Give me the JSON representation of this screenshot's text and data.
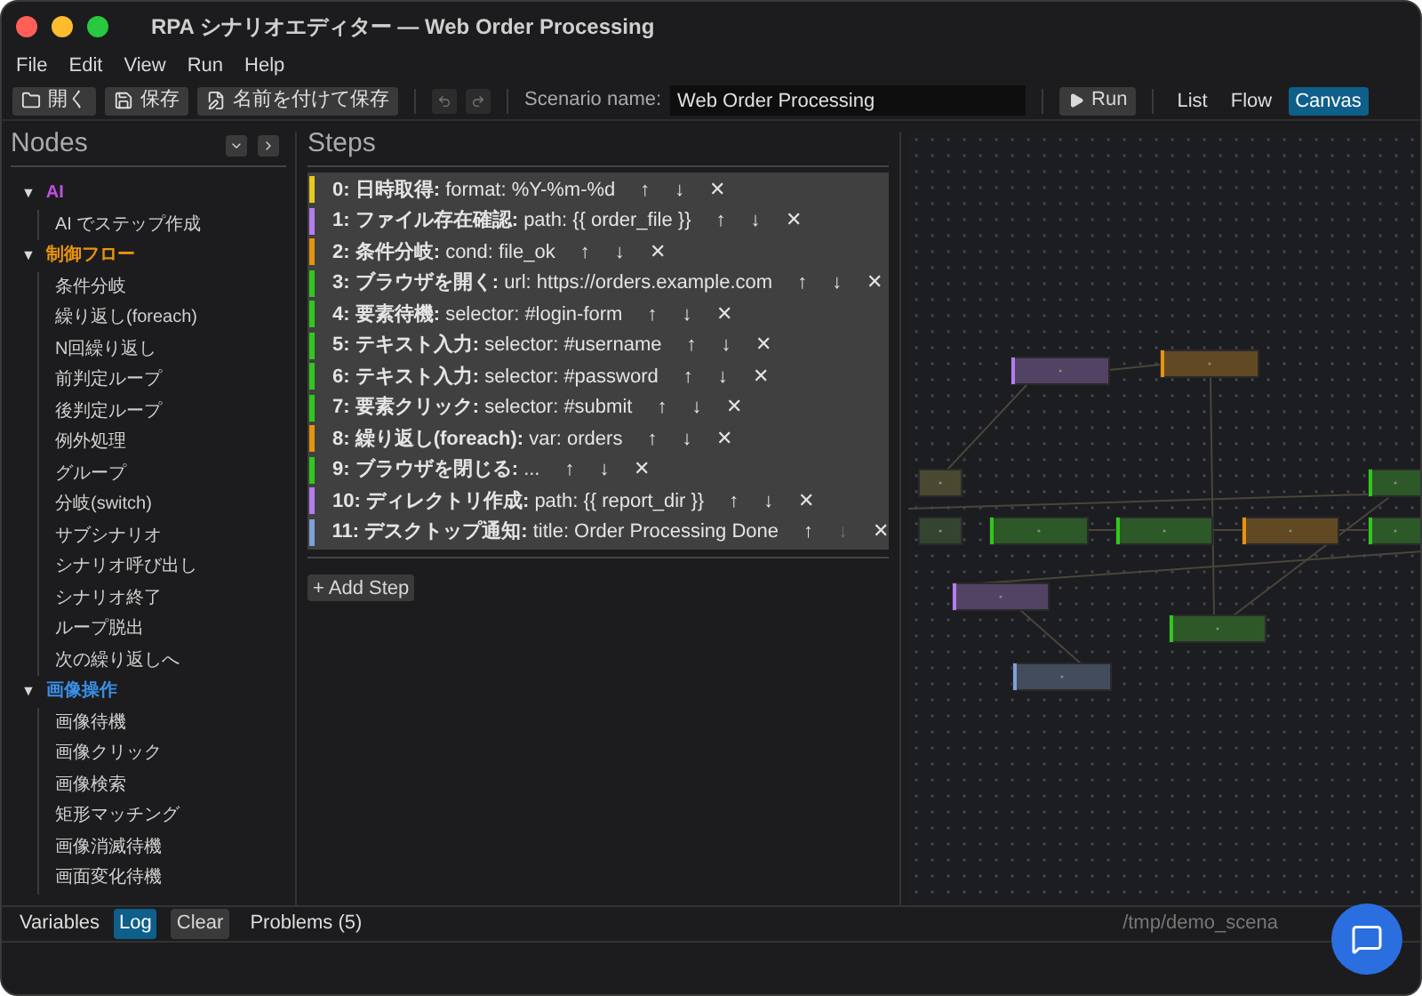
{
  "window": {
    "title": "RPA シナリオエディター — Web Order Processing"
  },
  "menu": [
    "File",
    "Edit",
    "View",
    "Run",
    "Help"
  ],
  "toolbar": {
    "file_buttons": [
      {
        "kind": "open",
        "label": "開く"
      },
      {
        "kind": "save",
        "label": "保存"
      },
      {
        "kind": "saveas",
        "label": "名前を付けて保存"
      }
    ],
    "scenario_label": "Scenario name:",
    "scenario_name": "Web Order Processing",
    "run": "Run",
    "views": [
      {
        "label": "List",
        "selected": false
      },
      {
        "label": "Flow",
        "selected": false
      },
      {
        "label": "Canvas",
        "selected": true
      }
    ]
  },
  "nodes_panel": {
    "title": "Nodes",
    "groups": [
      {
        "label": "AI",
        "color": "#c050e0",
        "expanded": true,
        "marker": "▼",
        "children": [
          "AI でステップ作成"
        ]
      },
      {
        "label": "制御フロー",
        "color": "#e8930c",
        "expanded": true,
        "marker": "▼",
        "children": [
          "条件分岐",
          "繰り返し(foreach)",
          "N回繰り返し",
          "前判定ループ",
          "後判定ループ",
          "例外処理",
          "グループ",
          "分岐(switch)",
          "サブシナリオ",
          "シナリオ呼び出し",
          "シナリオ終了",
          "ループ脱出",
          "次の繰り返しへ"
        ]
      },
      {
        "label": "画像操作",
        "color": "#3a8ee6",
        "expanded": true,
        "marker": "▼",
        "children": [
          "画像待機",
          "画像クリック",
          "画像検索",
          "矩形マッチング",
          "画像消滅待機",
          "画面変化待機"
        ]
      }
    ]
  },
  "steps_panel": {
    "title": "Steps",
    "add": "+ Add Step",
    "steps": [
      {
        "color": "#e8c81c",
        "name": "0: 日時取得:",
        "detail": "format: %Y-%m-%d",
        "actions": [
          {
            "text": "↑",
            "disabled": false
          },
          {
            "text": "↓",
            "disabled": false
          },
          {
            "text": "✕",
            "disabled": false
          }
        ]
      },
      {
        "color": "#b57cf0",
        "name": "1: ファイル存在確認:",
        "detail": "path: {{ order_file }}",
        "actions": [
          {
            "text": "↑",
            "disabled": false
          },
          {
            "text": "↓",
            "disabled": false
          },
          {
            "text": "✕",
            "disabled": false
          }
        ]
      },
      {
        "color": "#e8930c",
        "name": "2: 条件分岐:",
        "detail": "cond: file_ok",
        "actions": [
          {
            "text": "↑",
            "disabled": false
          },
          {
            "text": "↓",
            "disabled": false
          },
          {
            "text": "✕",
            "disabled": false
          }
        ]
      },
      {
        "color": "#30c81c",
        "name": "3: ブラウザを開く:",
        "detail": "url: https://orders.example.com",
        "actions": [
          {
            "text": "↑",
            "disabled": false
          },
          {
            "text": "↓",
            "disabled": false
          },
          {
            "text": "✕",
            "disabled": false
          }
        ]
      },
      {
        "color": "#30c81c",
        "name": "4: 要素待機:",
        "detail": "selector: #login-form",
        "actions": [
          {
            "text": "↑",
            "disabled": false
          },
          {
            "text": "↓",
            "disabled": false
          },
          {
            "text": "✕",
            "disabled": false
          }
        ]
      },
      {
        "color": "#30c81c",
        "name": "5: テキスト入力:",
        "detail": "selector: #username",
        "actions": [
          {
            "text": "↑",
            "disabled": false
          },
          {
            "text": "↓",
            "disabled": false
          },
          {
            "text": "✕",
            "disabled": false
          }
        ]
      },
      {
        "color": "#30c81c",
        "name": "6: テキスト入力:",
        "detail": "selector: #password",
        "actions": [
          {
            "text": "↑",
            "disabled": false
          },
          {
            "text": "↓",
            "disabled": false
          },
          {
            "text": "✕",
            "disabled": false
          }
        ]
      },
      {
        "color": "#30c81c",
        "name": "7: 要素クリック:",
        "detail": "selector: #submit",
        "actions": [
          {
            "text": "↑",
            "disabled": false
          },
          {
            "text": "↓",
            "disabled": false
          },
          {
            "text": "✕",
            "disabled": false
          }
        ]
      },
      {
        "color": "#e8930c",
        "name": "8: 繰り返し(foreach):",
        "detail": "var: orders",
        "actions": [
          {
            "text": "↑",
            "disabled": false
          },
          {
            "text": "↓",
            "disabled": false
          },
          {
            "text": "✕",
            "disabled": false
          }
        ]
      },
      {
        "color": "#30c81c",
        "name": "9: ブラウザを閉じる:",
        "detail": "...",
        "actions": [
          {
            "text": "↑",
            "disabled": false
          },
          {
            "text": "↓",
            "disabled": false
          },
          {
            "text": "✕",
            "disabled": false
          }
        ]
      },
      {
        "color": "#b57cf0",
        "name": "10: ディレクトリ作成:",
        "detail": "path: {{ report_dir }}",
        "actions": [
          {
            "text": "↑",
            "disabled": false
          },
          {
            "text": "↓",
            "disabled": false
          },
          {
            "text": "✕",
            "disabled": false
          }
        ]
      },
      {
        "color": "#7fa0d8",
        "name": "11: デスクトップ通知:",
        "detail": "title: Order Processing Done",
        "actions": [
          {
            "text": "↑",
            "disabled": false
          },
          {
            "text": "↓",
            "disabled": true
          },
          {
            "text": "✕",
            "disabled": false
          }
        ]
      }
    ]
  },
  "canvas": {
    "nodes": [
      {
        "color": "#b57cf0"
      },
      {
        "color": "#e8930c"
      },
      {
        "color": "#4b4832"
      },
      {
        "color": "#30c81c"
      },
      {
        "color": "#34452f"
      },
      {
        "color": "#30c81c"
      },
      {
        "color": "#30c81c"
      },
      {
        "color": "#e8930c"
      },
      {
        "color": "#30c81c"
      },
      {
        "color": "#b57cf0"
      },
      {
        "color": "#30c81c"
      },
      {
        "color": "#7fa0d8"
      }
    ]
  },
  "bottom_bar": {
    "tabs": [
      {
        "label": "Variables",
        "selected": false
      },
      {
        "label": "Log",
        "selected": true
      }
    ],
    "clear": "Clear",
    "problems": "Problems (5)",
    "path": "/tmp/demo_scena"
  }
}
